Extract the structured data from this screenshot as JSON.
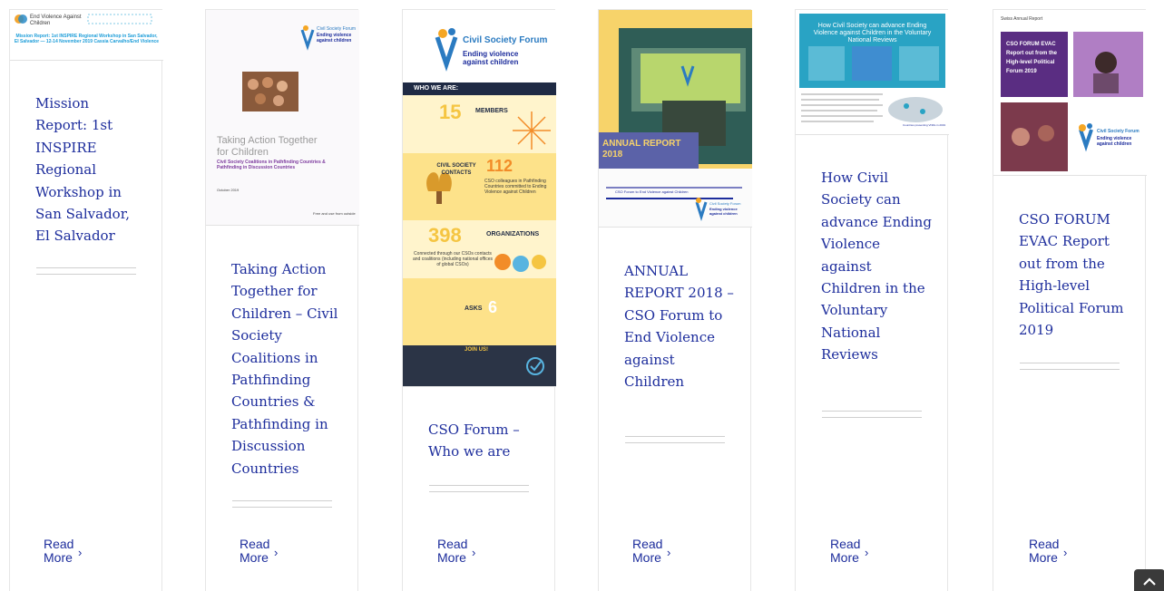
{
  "cards": [
    {
      "thumb": {
        "logo_text": "End Violence Against Children",
        "caption": "Mission Report: 1st INSPIRE Regional Workshop in San Salvador, El Salvador — 12-14 November 2019 Cassia Carvalho/End Violence"
      },
      "title": "Mission Report: 1st INSPIRE Regional Workshop in San Salvador, El Salvador",
      "read_more": "Read More"
    },
    {
      "thumb": {
        "logo_line1": "Civil Society Forum",
        "logo_line2": "Ending violence against children",
        "heading": "Taking Action Together for Children",
        "sub": "Civil Society Coalitions in Pathfinding Countries & Pathfinding in Discussion Countries",
        "date": "October 2019",
        "footer": "Free and use from outside"
      },
      "title": "Taking Action Together for Children – Civil Society Coalitions in Pathfinding Countries & Pathfinding in Discussion Countries",
      "read_more": "Read More"
    },
    {
      "thumb": {
        "logo_line1": "Civil Society Forum",
        "logo_line2": "Ending violence against children",
        "who": "WHO WE ARE:",
        "members_num": "15",
        "members_label": "MEMBERS",
        "contacts_label": "CIVIL SOCIETY CONTACTS",
        "contacts_num": "112",
        "contacts_text": "CSO colleagues in Pathfinding Countries committed to Ending Violence against Children",
        "org_num": "398",
        "org_label": "ORGANIZATIONS",
        "org_text": "Connected through our CSOs contacts and coalitions (including national offices of global CSOs)",
        "asks_label": "ASKS",
        "asks_num": "6",
        "join": "JOIN US!"
      },
      "title": "CSO Forum – Who we are",
      "read_more": "Read More"
    },
    {
      "thumb": {
        "banner": "ANNUAL REPORT 2018",
        "bottom_text": "CSO Forum to End Violence against Children",
        "logo_line1": "Civil Society Forum",
        "logo_line2": "Ending violence against children"
      },
      "title": "ANNUAL REPORT 2018 – CSO Forum to End Violence against Children",
      "read_more": "Read More"
    },
    {
      "thumb": {
        "heading": "How Civil Society can advance Ending Violence against Children in the Voluntary National Reviews",
        "legend": "Countries presenting VNRs in 2019"
      },
      "title": "How Civil Society can advance Ending Violence against Children in the Voluntary National Reviews",
      "read_more": "Read More"
    },
    {
      "thumb": {
        "top_label": "Swiss Annual Report",
        "overlay": "CSO FORUM EVAC Report out from the High-level Political Forum 2019",
        "logo_line1": "Civil Society Forum",
        "logo_line2": "Ending violence against children"
      },
      "title": "CSO FORUM EVAC Report out from the High-level Political Forum 2019",
      "read_more": "Read More"
    }
  ],
  "colors": {
    "link": "#1d2d9c",
    "rule": "#cfcfcf",
    "border": "#e6e6e6"
  },
  "icons": {
    "read_more": "chevron-right-icon",
    "scroll_top": "chevron-up-icon"
  }
}
